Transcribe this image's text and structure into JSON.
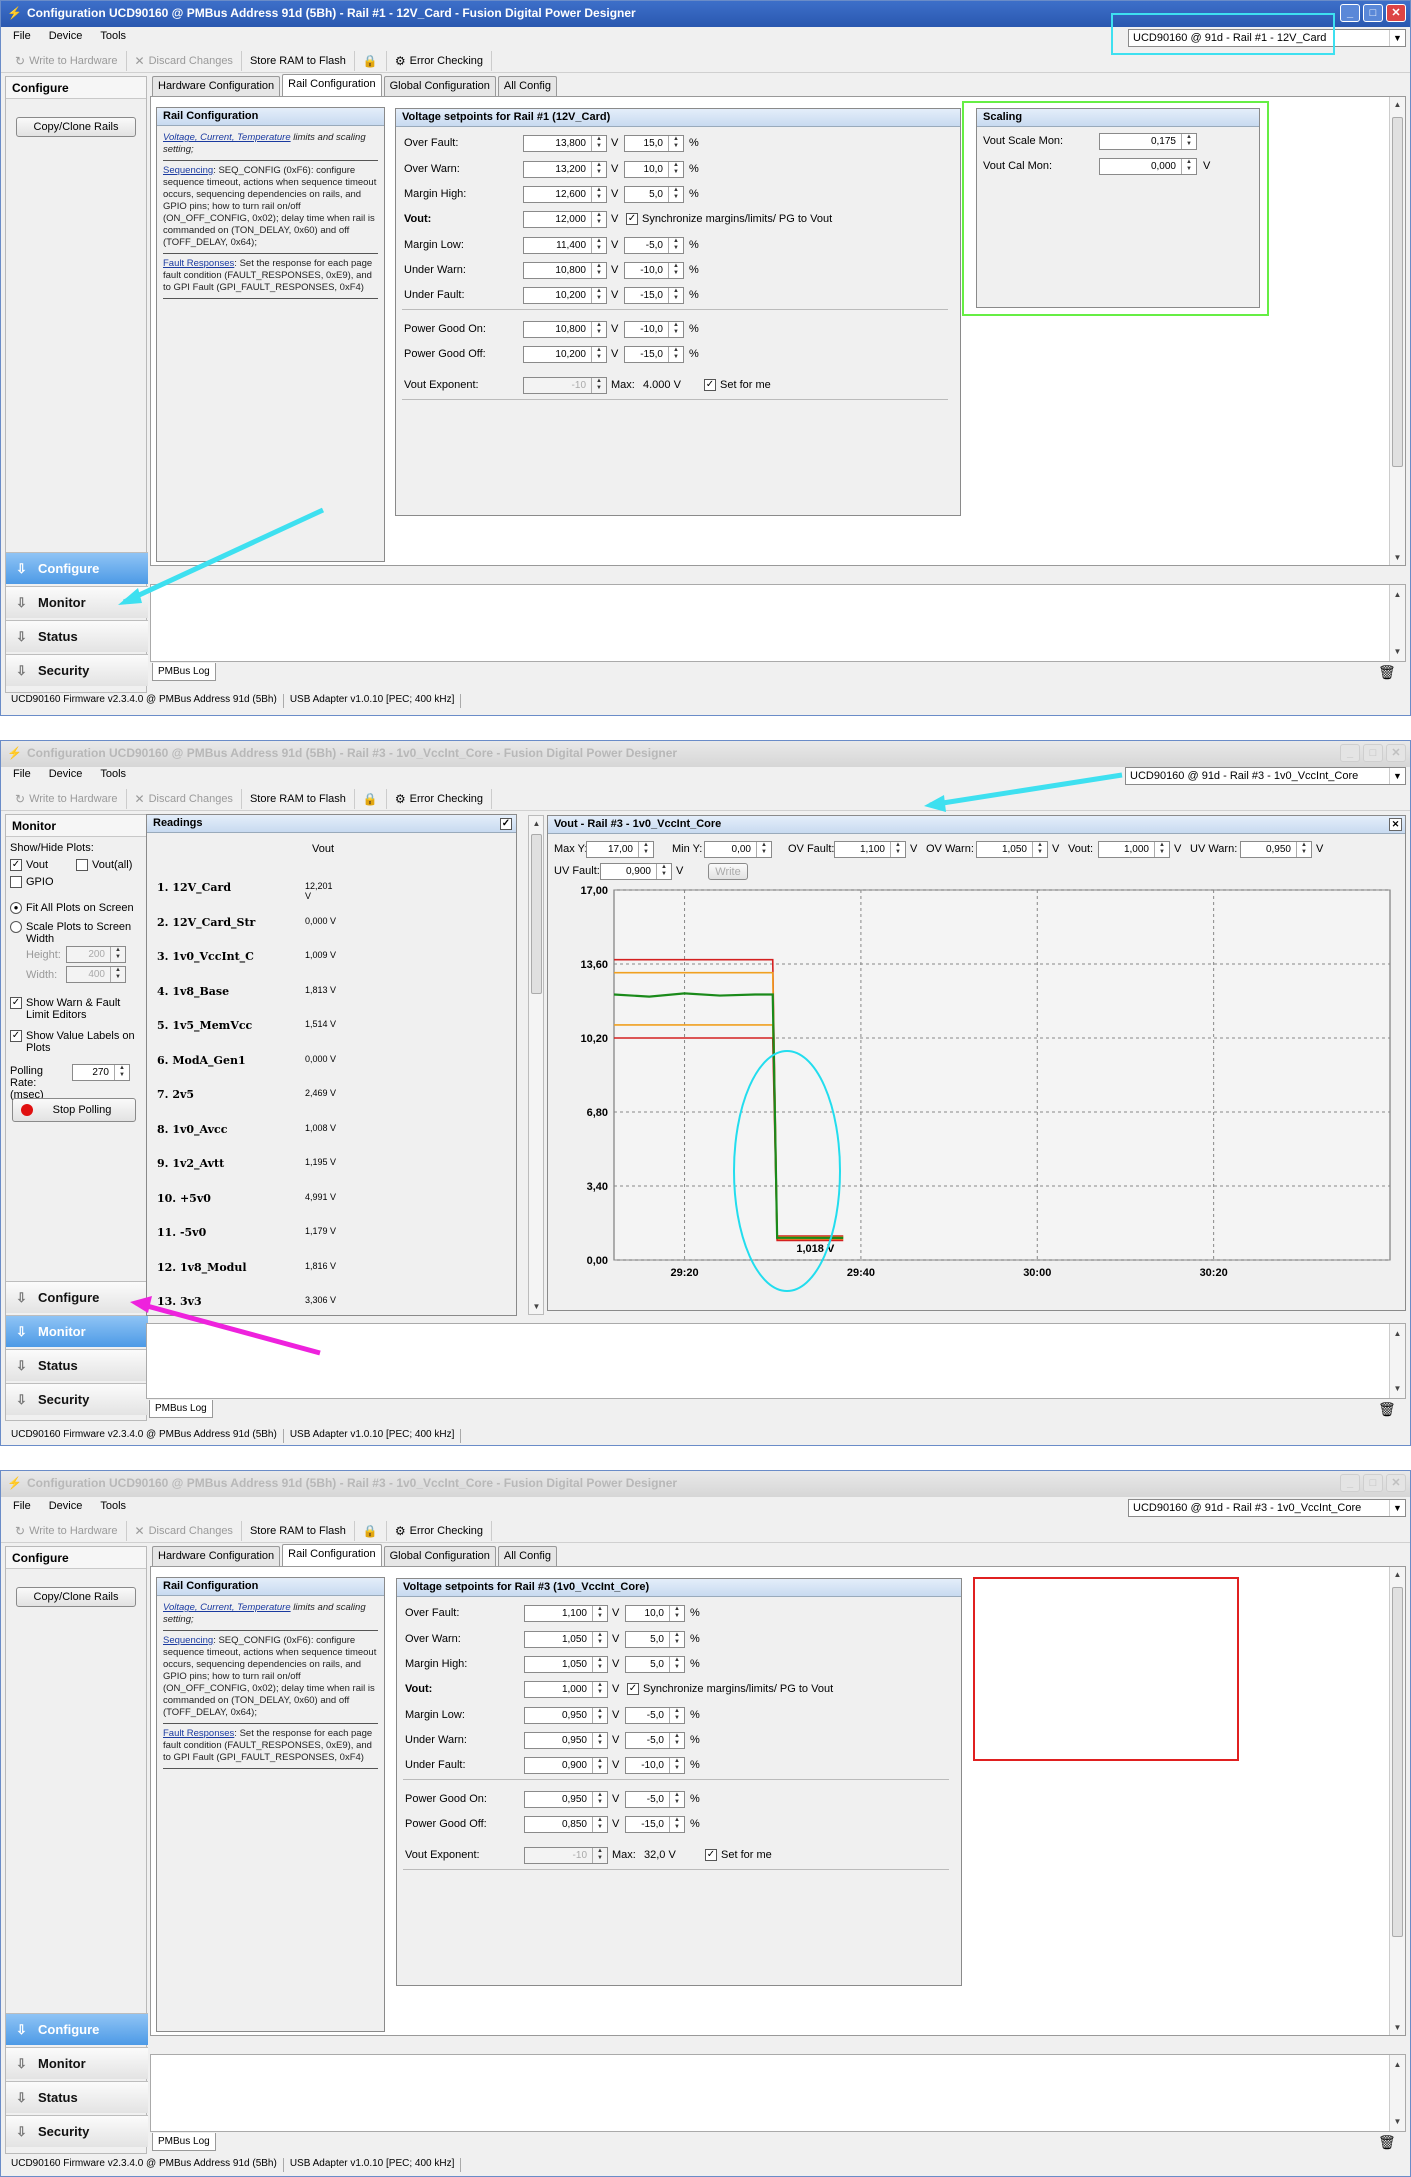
{
  "screens": [
    {
      "title": "Configuration UCD90160 @ PMBus Address 91d (5Bh) - Rail #1 - 12V_Card - Fusion Digital Power Designer",
      "device_select": "UCD90160 @ 91d - Rail #1 - 12V_Card"
    },
    {
      "title": "Configuration UCD90160 @ PMBus Address 91d (5Bh) - Rail #3 - 1v0_VccInt_Core - Fusion Digital Power Designer",
      "device_select": "UCD90160 @ 91d - Rail #3 - 1v0_VccInt_Core"
    },
    {
      "title": "Configuration UCD90160 @ PMBus Address 91d (5Bh) - Rail #3 - 1v0_VccInt_Core - Fusion Digital Power Designer",
      "device_select": "UCD90160 @ 91d - Rail #3 - 1v0_VccInt_Core"
    }
  ],
  "menu": {
    "file": "File",
    "device": "Device",
    "tools": "Tools"
  },
  "toolbar": {
    "write": "Write to Hardware",
    "discard": "Discard Changes",
    "store": "Store RAM to Flash",
    "error": "Error Checking"
  },
  "nav": {
    "configure": "Configure",
    "monitor": "Monitor",
    "status": "Status",
    "security": "Security"
  },
  "configure_panel": {
    "title": "Configure",
    "copy_clone": "Copy/Clone Rails"
  },
  "tabs": [
    "Hardware Configuration",
    "Rail Configuration",
    "Global Configuration",
    "All Config"
  ],
  "rail_config": {
    "title": "Rail Configuration",
    "link1": "Voltage, Current, Temperature",
    "text1": " limits and scaling setting;",
    "link2": "Sequencing",
    "text2": ": SEQ_CONFIG (0xF6): configure sequence timeout, actions when sequence timeout occurs, sequencing dependencies on rails, and GPIO pins; how to turn rail on/off (ON_OFF_CONFIG, 0x02); delay time when rail is commanded on (TON_DELAY, 0x60) and off (TOFF_DELAY, 0x64);",
    "link3": "Fault Responses",
    "text3": ": Set the response for each page fault condition (FAULT_RESPONSES, 0xE9), and to GPI Fault (GPI_FAULT_RESPONSES, 0xF4)"
  },
  "labels": {
    "over_fault": "Over Fault:",
    "over_warn": "Over Warn:",
    "margin_high": "Margin High:",
    "vout": "Vout:",
    "margin_low": "Margin Low:",
    "under_warn": "Under Warn:",
    "under_fault": "Under Fault:",
    "pg_on": "Power Good On:",
    "pg_off": "Power Good Off:",
    "vout_exp": "Vout Exponent:",
    "max": "Max:",
    "set_for_me": "Set for me",
    "sync": "Synchronize margins/limits/ PG to Vout",
    "v": "V",
    "pct": "%"
  },
  "setpoints_rail1": {
    "title": "Voltage setpoints for Rail #1 (12V_Card)",
    "over_fault": [
      "13,800",
      "15,0"
    ],
    "over_warn": [
      "13,200",
      "10,0"
    ],
    "margin_high": [
      "12,600",
      "5,0"
    ],
    "vout": "12,000",
    "margin_low": [
      "11,400",
      "-5,0"
    ],
    "under_warn": [
      "10,800",
      "-10,0"
    ],
    "under_fault": [
      "10,200",
      "-15,0"
    ],
    "pg_on": [
      "10,800",
      "-10,0"
    ],
    "pg_off": [
      "10,200",
      "-15,0"
    ],
    "vout_exp": "-10",
    "max": "4.000 V"
  },
  "setpoints_rail3": {
    "title": "Voltage setpoints for Rail #3 (1v0_VccInt_Core)",
    "over_fault": [
      "1,100",
      "10,0"
    ],
    "over_warn": [
      "1,050",
      "5,0"
    ],
    "margin_high": [
      "1,050",
      "5,0"
    ],
    "vout": "1,000",
    "margin_low": [
      "0,950",
      "-5,0"
    ],
    "under_warn": [
      "0,950",
      "-5,0"
    ],
    "under_fault": [
      "0,900",
      "-10,0"
    ],
    "pg_on": [
      "0,950",
      "-5,0"
    ],
    "pg_off": [
      "0,850",
      "-15,0"
    ],
    "vout_exp": "-10",
    "max": "32,0 V"
  },
  "scaling": {
    "title": "Scaling",
    "scale_mon_label": "Vout Scale Mon:",
    "scale_mon": "0,175",
    "cal_mon_label": "Vout Cal Mon:",
    "cal_mon": "0,000"
  },
  "log_tab": "PMBus Log",
  "status_bar": {
    "firmware": "UCD90160 Firmware v2.3.4.0 @ PMBus Address 91d (5Bh)",
    "adapter": "USB Adapter v1.0.10 [PEC; 400 kHz]"
  },
  "monitor": {
    "title": "Monitor",
    "show_hide": "Show/Hide Plots:",
    "vout": "Vout",
    "vout_all": "Vout(all)",
    "gpio": "GPIO",
    "fit_all": "Fit All Plots on Screen",
    "scale_plots": "Scale Plots to Screen Width",
    "height_label": "Height:",
    "height": "200",
    "width_label": "Width:",
    "width": "400",
    "show_warn": "Show Warn & Fault Limit Editors",
    "show_value": "Show Value Labels on Plots",
    "polling_label": "Polling Rate: (msec)",
    "polling": "270",
    "stop": "Stop Polling"
  },
  "readings": {
    "title": "Readings",
    "col": "Vout",
    "rows": [
      {
        "name": "1. 12V_Card",
        "value": "12,201 V"
      },
      {
        "name": "2. 12V_Card_Str",
        "value": "0,000 V"
      },
      {
        "name": "3. 1v0_VccInt_C",
        "value": "1,009 V"
      },
      {
        "name": "4. 1v8_Base",
        "value": "1,813 V"
      },
      {
        "name": "5. 1v5_MemVcc",
        "value": "1,514 V"
      },
      {
        "name": "6. ModA_Gen1",
        "value": "0,000 V"
      },
      {
        "name": "7. 2v5",
        "value": "2,469 V"
      },
      {
        "name": "8. 1v0_Avcc",
        "value": "1,008 V"
      },
      {
        "name": "9. 1v2_Avtt",
        "value": "1,195 V"
      },
      {
        "name": "10. +5v0",
        "value": "4,991 V"
      },
      {
        "name": "11. -5v0",
        "value": "1,179 V"
      },
      {
        "name": "12. 1v8_Modul",
        "value": "1,816 V"
      },
      {
        "name": "13. 3v3",
        "value": "3,306 V"
      }
    ]
  },
  "plot": {
    "title": "Vout - Rail #3 - 1v0_VccInt_Core",
    "max_y_label": "Max Y:",
    "max_y": "17,00",
    "min_y_label": "Min Y:",
    "min_y": "0,00",
    "ov_fault_label": "OV Fault:",
    "ov_fault": "1,100",
    "ov_warn_label": "OV Warn:",
    "ov_warn": "1,050",
    "vout_label": "Vout:",
    "vout": "1,000",
    "uv_warn_label": "UV Warn:",
    "uv_warn": "0,950",
    "uv_fault_label": "UV Fault:",
    "uv_fault": "0,900",
    "write": "Write",
    "value_label": "1,018 V"
  },
  "chart_data": {
    "type": "line",
    "title": "Vout - Rail #3 - 1v0_VccInt_Core",
    "ylim": [
      0,
      17
    ],
    "yticks": [
      "17,00",
      "13,60",
      "10,20",
      "6,80",
      "3,40",
      "0,00"
    ],
    "xticks": [
      "29:20",
      "29:40",
      "30:00",
      "30:20"
    ],
    "xlim_seconds": [
      1152,
      1240
    ],
    "series": [
      {
        "color": "#d42020",
        "x": [
          1152,
          1170,
          1170.5,
          1172,
          1178
        ],
        "y": [
          13.8,
          13.8,
          1.1,
          1.1,
          1.1
        ]
      },
      {
        "color": "#f0a020",
        "x": [
          1152,
          1170,
          1170.5,
          1172,
          1178
        ],
        "y": [
          13.2,
          13.2,
          1.05,
          1.05,
          1.05
        ]
      },
      {
        "color": "#f0a020",
        "x": [
          1152,
          1170,
          1170.5,
          1172,
          1178
        ],
        "y": [
          10.8,
          10.8,
          0.95,
          0.95,
          0.95
        ]
      },
      {
        "color": "#d42020",
        "x": [
          1152,
          1170,
          1170.5,
          1172,
          1178
        ],
        "y": [
          10.2,
          10.2,
          0.9,
          0.9,
          0.9
        ]
      },
      {
        "color": "#1a8a1a",
        "x": [
          1152,
          1156,
          1160,
          1164,
          1168,
          1170,
          1170.5,
          1172,
          1178
        ],
        "y": [
          12.2,
          12.1,
          12.25,
          12.15,
          12.2,
          12.2,
          1.02,
          1.02,
          1.018
        ]
      }
    ]
  },
  "colors": {
    "arrow_cyan": "#3ee0f0",
    "arrow_magenta": "#ee22dd",
    "box_green": "#66ee44",
    "box_red": "#e02020",
    "ellipse": "#22ddee"
  }
}
